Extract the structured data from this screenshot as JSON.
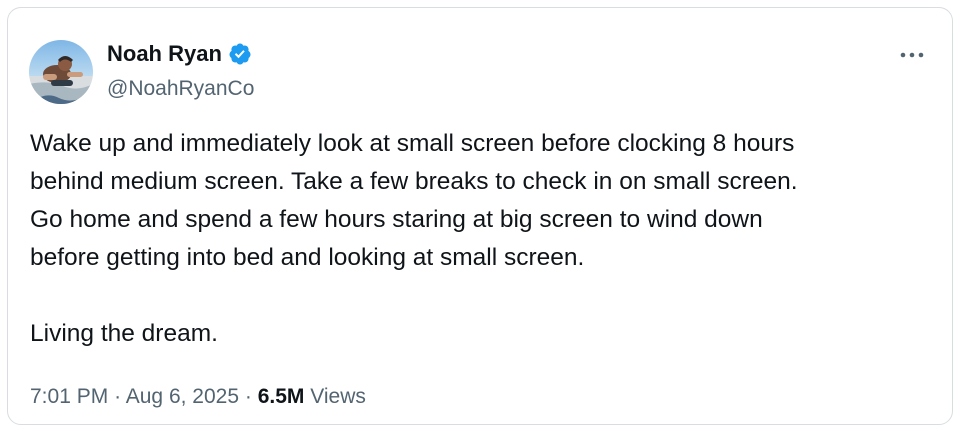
{
  "author": {
    "display_name": "Noah Ryan",
    "handle": "@NoahRyanCo",
    "verified": true,
    "verified_icon": "verified-badge-icon",
    "avatar_icon": "profile-photo"
  },
  "more_menu_icon": "more-horizontal-icon",
  "tweet": {
    "paragraph_1_lines": [
      "Wake up and immediately look at small screen before clocking 8 hours",
      "behind medium screen. Take a few breaks to check in on small screen.",
      "Go home and spend a few hours staring at big screen to wind down",
      "before getting into bed and looking at small screen."
    ],
    "paragraph_2": "Living the dream."
  },
  "meta": {
    "time": "7:01 PM",
    "separator": "·",
    "date": "Aug 6, 2025",
    "views_count": "6.5M",
    "views_label": "Views"
  },
  "colors": {
    "text_primary": "#0f1419",
    "text_secondary": "#536471",
    "verified_blue": "#1d9bf0",
    "border": "#d8dde1"
  }
}
